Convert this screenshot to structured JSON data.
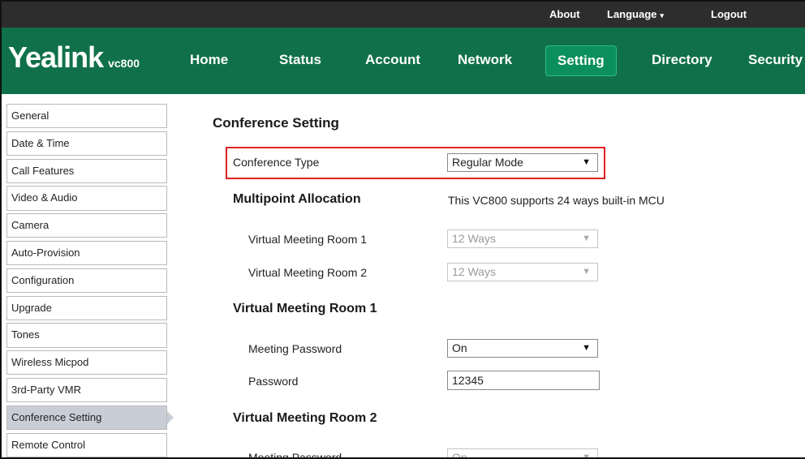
{
  "topbar": {
    "about": "About",
    "language": "Language",
    "language_caret": "▾",
    "logout": "Logout"
  },
  "brand": {
    "name": "Yealink",
    "model": "vc800"
  },
  "nav": {
    "home": "Home",
    "status": "Status",
    "account": "Account",
    "network": "Network",
    "setting": "Setting",
    "directory": "Directory",
    "security": "Security"
  },
  "sidebar": {
    "items": [
      {
        "label": "General"
      },
      {
        "label": "Date & Time"
      },
      {
        "label": "Call Features"
      },
      {
        "label": "Video & Audio"
      },
      {
        "label": "Camera"
      },
      {
        "label": "Auto-Provision"
      },
      {
        "label": "Configuration"
      },
      {
        "label": "Upgrade"
      },
      {
        "label": "Tones"
      },
      {
        "label": "Wireless Micpod"
      },
      {
        "label": "3rd-Party VMR"
      },
      {
        "label": "Conference Setting"
      },
      {
        "label": "Remote Control"
      }
    ],
    "active": "Conference Setting"
  },
  "main": {
    "title": "Conference Setting",
    "conference_type": {
      "label": "Conference Type",
      "value": "Regular Mode",
      "arrow": "▼"
    },
    "multipoint": {
      "heading": "Multipoint Allocation",
      "info": "This VC800 supports 24 ways built-in MCU",
      "vmr1": {
        "label": "Virtual Meeting Room 1",
        "value": "12 Ways",
        "arrow": "▼"
      },
      "vmr2": {
        "label": "Virtual Meeting Room 2",
        "value": "12 Ways",
        "arrow": "▼"
      }
    },
    "room1": {
      "heading": "Virtual Meeting Room 1",
      "meeting_password": {
        "label": "Meeting Password",
        "value": "On",
        "arrow": "▼"
      },
      "password": {
        "label": "Password",
        "value": "12345"
      }
    },
    "room2": {
      "heading": "Virtual Meeting Room 2",
      "meeting_password": {
        "label": "Meeting Password",
        "value": "On",
        "arrow": "▼"
      }
    }
  },
  "colors": {
    "nav_green": "#10704a",
    "active_tab": "#0b8f5c",
    "topbar": "#2d2d2d",
    "highlight": "#e02020",
    "sidebar_active": "#c9ced6"
  }
}
